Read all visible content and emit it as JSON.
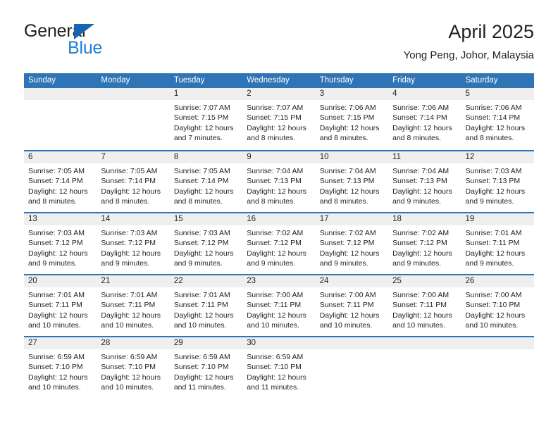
{
  "brand": {
    "name_part1": "General",
    "name_part2": "Blue",
    "triangle_icon": "brand-triangle-icon",
    "accent_color": "#1565b0",
    "blue_text_color": "#1b7fd4"
  },
  "header": {
    "title": "April 2025",
    "subtitle": "Yong Peng, Johor, Malaysia"
  },
  "theme": {
    "header_blue": "#2f74b5",
    "day_band_gray": "#efefef",
    "text": "#231f20"
  },
  "calendar": {
    "day_names": [
      "Sunday",
      "Monday",
      "Tuesday",
      "Wednesday",
      "Thursday",
      "Friday",
      "Saturday"
    ],
    "weeks": [
      [
        {
          "day": "",
          "sunrise": "",
          "sunset": "",
          "daylight": "",
          "empty": true
        },
        {
          "day": "",
          "sunrise": "",
          "sunset": "",
          "daylight": "",
          "empty": true
        },
        {
          "day": "1",
          "sunrise": "Sunrise: 7:07 AM",
          "sunset": "Sunset: 7:15 PM",
          "daylight": "Daylight: 12 hours and 7 minutes.",
          "empty": false
        },
        {
          "day": "2",
          "sunrise": "Sunrise: 7:07 AM",
          "sunset": "Sunset: 7:15 PM",
          "daylight": "Daylight: 12 hours and 8 minutes.",
          "empty": false
        },
        {
          "day": "3",
          "sunrise": "Sunrise: 7:06 AM",
          "sunset": "Sunset: 7:15 PM",
          "daylight": "Daylight: 12 hours and 8 minutes.",
          "empty": false
        },
        {
          "day": "4",
          "sunrise": "Sunrise: 7:06 AM",
          "sunset": "Sunset: 7:14 PM",
          "daylight": "Daylight: 12 hours and 8 minutes.",
          "empty": false
        },
        {
          "day": "5",
          "sunrise": "Sunrise: 7:06 AM",
          "sunset": "Sunset: 7:14 PM",
          "daylight": "Daylight: 12 hours and 8 minutes.",
          "empty": false
        }
      ],
      [
        {
          "day": "6",
          "sunrise": "Sunrise: 7:05 AM",
          "sunset": "Sunset: 7:14 PM",
          "daylight": "Daylight: 12 hours and 8 minutes.",
          "empty": false
        },
        {
          "day": "7",
          "sunrise": "Sunrise: 7:05 AM",
          "sunset": "Sunset: 7:14 PM",
          "daylight": "Daylight: 12 hours and 8 minutes.",
          "empty": false
        },
        {
          "day": "8",
          "sunrise": "Sunrise: 7:05 AM",
          "sunset": "Sunset: 7:14 PM",
          "daylight": "Daylight: 12 hours and 8 minutes.",
          "empty": false
        },
        {
          "day": "9",
          "sunrise": "Sunrise: 7:04 AM",
          "sunset": "Sunset: 7:13 PM",
          "daylight": "Daylight: 12 hours and 8 minutes.",
          "empty": false
        },
        {
          "day": "10",
          "sunrise": "Sunrise: 7:04 AM",
          "sunset": "Sunset: 7:13 PM",
          "daylight": "Daylight: 12 hours and 8 minutes.",
          "empty": false
        },
        {
          "day": "11",
          "sunrise": "Sunrise: 7:04 AM",
          "sunset": "Sunset: 7:13 PM",
          "daylight": "Daylight: 12 hours and 9 minutes.",
          "empty": false
        },
        {
          "day": "12",
          "sunrise": "Sunrise: 7:03 AM",
          "sunset": "Sunset: 7:13 PM",
          "daylight": "Daylight: 12 hours and 9 minutes.",
          "empty": false
        }
      ],
      [
        {
          "day": "13",
          "sunrise": "Sunrise: 7:03 AM",
          "sunset": "Sunset: 7:12 PM",
          "daylight": "Daylight: 12 hours and 9 minutes.",
          "empty": false
        },
        {
          "day": "14",
          "sunrise": "Sunrise: 7:03 AM",
          "sunset": "Sunset: 7:12 PM",
          "daylight": "Daylight: 12 hours and 9 minutes.",
          "empty": false
        },
        {
          "day": "15",
          "sunrise": "Sunrise: 7:03 AM",
          "sunset": "Sunset: 7:12 PM",
          "daylight": "Daylight: 12 hours and 9 minutes.",
          "empty": false
        },
        {
          "day": "16",
          "sunrise": "Sunrise: 7:02 AM",
          "sunset": "Sunset: 7:12 PM",
          "daylight": "Daylight: 12 hours and 9 minutes.",
          "empty": false
        },
        {
          "day": "17",
          "sunrise": "Sunrise: 7:02 AM",
          "sunset": "Sunset: 7:12 PM",
          "daylight": "Daylight: 12 hours and 9 minutes.",
          "empty": false
        },
        {
          "day": "18",
          "sunrise": "Sunrise: 7:02 AM",
          "sunset": "Sunset: 7:12 PM",
          "daylight": "Daylight: 12 hours and 9 minutes.",
          "empty": false
        },
        {
          "day": "19",
          "sunrise": "Sunrise: 7:01 AM",
          "sunset": "Sunset: 7:11 PM",
          "daylight": "Daylight: 12 hours and 9 minutes.",
          "empty": false
        }
      ],
      [
        {
          "day": "20",
          "sunrise": "Sunrise: 7:01 AM",
          "sunset": "Sunset: 7:11 PM",
          "daylight": "Daylight: 12 hours and 10 minutes.",
          "empty": false
        },
        {
          "day": "21",
          "sunrise": "Sunrise: 7:01 AM",
          "sunset": "Sunset: 7:11 PM",
          "daylight": "Daylight: 12 hours and 10 minutes.",
          "empty": false
        },
        {
          "day": "22",
          "sunrise": "Sunrise: 7:01 AM",
          "sunset": "Sunset: 7:11 PM",
          "daylight": "Daylight: 12 hours and 10 minutes.",
          "empty": false
        },
        {
          "day": "23",
          "sunrise": "Sunrise: 7:00 AM",
          "sunset": "Sunset: 7:11 PM",
          "daylight": "Daylight: 12 hours and 10 minutes.",
          "empty": false
        },
        {
          "day": "24",
          "sunrise": "Sunrise: 7:00 AM",
          "sunset": "Sunset: 7:11 PM",
          "daylight": "Daylight: 12 hours and 10 minutes.",
          "empty": false
        },
        {
          "day": "25",
          "sunrise": "Sunrise: 7:00 AM",
          "sunset": "Sunset: 7:11 PM",
          "daylight": "Daylight: 12 hours and 10 minutes.",
          "empty": false
        },
        {
          "day": "26",
          "sunrise": "Sunrise: 7:00 AM",
          "sunset": "Sunset: 7:10 PM",
          "daylight": "Daylight: 12 hours and 10 minutes.",
          "empty": false
        }
      ],
      [
        {
          "day": "27",
          "sunrise": "Sunrise: 6:59 AM",
          "sunset": "Sunset: 7:10 PM",
          "daylight": "Daylight: 12 hours and 10 minutes.",
          "empty": false
        },
        {
          "day": "28",
          "sunrise": "Sunrise: 6:59 AM",
          "sunset": "Sunset: 7:10 PM",
          "daylight": "Daylight: 12 hours and 10 minutes.",
          "empty": false
        },
        {
          "day": "29",
          "sunrise": "Sunrise: 6:59 AM",
          "sunset": "Sunset: 7:10 PM",
          "daylight": "Daylight: 12 hours and 11 minutes.",
          "empty": false
        },
        {
          "day": "30",
          "sunrise": "Sunrise: 6:59 AM",
          "sunset": "Sunset: 7:10 PM",
          "daylight": "Daylight: 12 hours and 11 minutes.",
          "empty": false
        },
        {
          "day": "",
          "sunrise": "",
          "sunset": "",
          "daylight": "",
          "empty": true
        },
        {
          "day": "",
          "sunrise": "",
          "sunset": "",
          "daylight": "",
          "empty": true
        },
        {
          "day": "",
          "sunrise": "",
          "sunset": "",
          "daylight": "",
          "empty": true
        }
      ]
    ]
  }
}
